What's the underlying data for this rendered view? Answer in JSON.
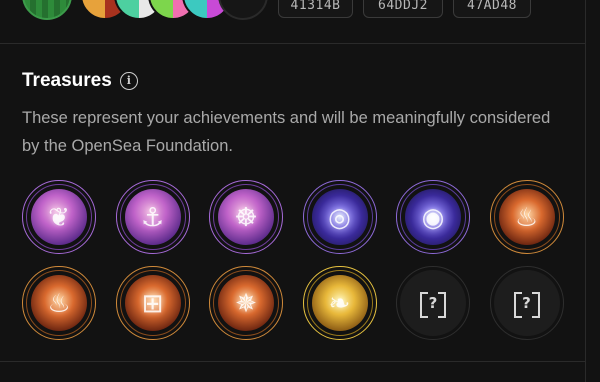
{
  "top": {
    "codes": [
      "41314B",
      "64DDJ2",
      "47AD48"
    ]
  },
  "treasures": {
    "title": "Treasures",
    "info_icon": "info-icon",
    "description": "These represent your achievements and will be meaningfully considered by the OpenSea Foundation.",
    "badges": [
      {
        "style": "purple",
        "icon": "heart-emblem-icon",
        "glyph": "❦",
        "locked": false
      },
      {
        "style": "purple",
        "icon": "anchor-emblem-icon",
        "glyph": "⚓",
        "locked": false
      },
      {
        "style": "purple",
        "icon": "ship-wheel-emblem-icon",
        "glyph": "☸",
        "locked": false
      },
      {
        "style": "orb",
        "icon": "swirl-orb-icon",
        "glyph": "◎",
        "locked": false
      },
      {
        "style": "orb",
        "icon": "orbit-orb-icon",
        "glyph": "◉",
        "locked": false
      },
      {
        "style": "orange",
        "icon": "flame-emblem-icon",
        "glyph": "♨",
        "locked": false
      },
      {
        "style": "orange",
        "icon": "fire-emblem-icon",
        "glyph": "♨",
        "locked": false
      },
      {
        "style": "orange",
        "icon": "treasure-chest-emblem-icon",
        "glyph": "⊞",
        "locked": false
      },
      {
        "style": "orange",
        "icon": "compass-emblem-icon",
        "glyph": "✵",
        "locked": false
      },
      {
        "style": "gold",
        "icon": "leaf-emblem-icon",
        "glyph": "❧",
        "locked": false
      },
      {
        "style": "locked",
        "icon": "locked-treasure-icon",
        "glyph": "?",
        "locked": true
      },
      {
        "style": "locked",
        "icon": "locked-treasure-icon",
        "glyph": "?",
        "locked": true
      }
    ]
  }
}
